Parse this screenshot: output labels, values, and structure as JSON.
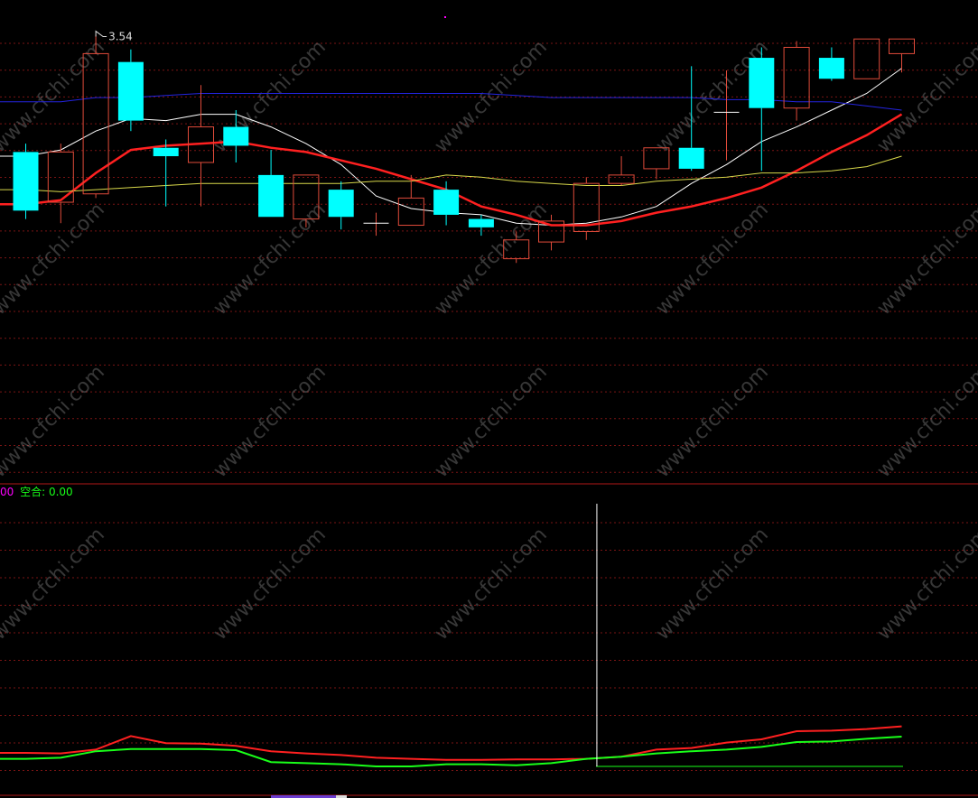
{
  "watermark": "www.cfchi.com",
  "colors": {
    "up": "#e04b3a",
    "down": "#00ffff",
    "ma5": "#ffffff",
    "ma10": "#ff2020",
    "ma20": "#d8d84a",
    "ma60": "#2424e0",
    "indicator_red": "#ff2020",
    "indicator_green": "#19ff19",
    "grid": "#7a1414"
  },
  "indicator": {
    "legend_left_fragment": "00",
    "legend_left_color": "#ff00ff",
    "legend_label": "空合: 0.00",
    "legend_color": "#19ff19"
  },
  "chart_data": [
    {
      "type": "candlestick",
      "title": "",
      "ylim": [
        2.05,
        3.62
      ],
      "high_marker": {
        "label": "3.54",
        "value": 3.54,
        "bar_index": 2
      },
      "candles": [
        {
          "open": 2.98,
          "close": 2.7,
          "high": 3.02,
          "low": 2.66
        },
        {
          "open": 2.74,
          "close": 2.98,
          "high": 3.02,
          "low": 2.64
        },
        {
          "open": 2.78,
          "close": 3.45,
          "high": 3.54,
          "low": 2.76
        },
        {
          "open": 3.41,
          "close": 3.13,
          "high": 3.47,
          "low": 3.08
        },
        {
          "open": 3.0,
          "close": 2.96,
          "high": 3.04,
          "low": 2.72
        },
        {
          "open": 2.93,
          "close": 3.1,
          "high": 3.3,
          "low": 2.72
        },
        {
          "open": 3.1,
          "close": 3.01,
          "high": 3.18,
          "low": 2.93
        },
        {
          "open": 2.87,
          "close": 2.67,
          "high": 2.99,
          "low": 2.67
        },
        {
          "open": 2.66,
          "close": 2.87,
          "high": 2.87,
          "low": 2.62
        },
        {
          "open": 2.8,
          "close": 2.67,
          "high": 2.84,
          "low": 2.61
        },
        {
          "open": 2.64,
          "close": 2.64,
          "high": 2.69,
          "low": 2.58
        },
        {
          "open": 2.63,
          "close": 2.76,
          "high": 2.87,
          "low": 2.63
        },
        {
          "open": 2.8,
          "close": 2.68,
          "high": 2.84,
          "low": 2.63
        },
        {
          "open": 2.66,
          "close": 2.62,
          "high": 2.68,
          "low": 2.58
        },
        {
          "open": 2.47,
          "close": 2.56,
          "high": 2.6,
          "low": 2.45
        },
        {
          "open": 2.55,
          "close": 2.65,
          "high": 2.68,
          "low": 2.51
        },
        {
          "open": 2.6,
          "close": 2.83,
          "high": 2.86,
          "low": 2.56
        },
        {
          "open": 2.83,
          "close": 2.87,
          "high": 2.96,
          "low": 2.82
        },
        {
          "open": 2.9,
          "close": 3.0,
          "high": 3.0,
          "low": 2.85
        },
        {
          "open": 3.0,
          "close": 2.9,
          "high": 3.39,
          "low": 2.89
        },
        {
          "open": 3.17,
          "close": 3.17,
          "high": 3.37,
          "low": 2.94
        },
        {
          "open": 3.43,
          "close": 3.19,
          "high": 3.48,
          "low": 2.89
        },
        {
          "open": 3.19,
          "close": 3.48,
          "high": 3.51,
          "low": 3.13
        },
        {
          "open": 3.43,
          "close": 3.33,
          "high": 3.48,
          "low": 3.32
        },
        {
          "open": 3.33,
          "close": 3.52,
          "high": 3.52,
          "low": 3.33
        },
        {
          "open": 3.45,
          "close": 3.52,
          "high": 3.52,
          "low": 3.36
        }
      ],
      "moving_averages": [
        {
          "color_key": "ma5",
          "width": 1,
          "values": [
            2.96,
            2.99,
            3.08,
            3.14,
            3.13,
            3.16,
            3.16,
            3.1,
            3.02,
            2.92,
            2.77,
            2.71,
            2.69,
            2.68,
            2.64,
            2.63,
            2.64,
            2.67,
            2.72,
            2.83,
            2.92,
            3.03,
            3.1,
            3.18,
            3.26,
            3.38
          ]
        },
        {
          "color_key": "ma10",
          "width": 2.5,
          "values": [
            2.73,
            2.75,
            2.88,
            2.99,
            3.01,
            3.02,
            3.03,
            3.0,
            2.98,
            2.94,
            2.9,
            2.85,
            2.8,
            2.72,
            2.68,
            2.63,
            2.63,
            2.65,
            2.69,
            2.72,
            2.76,
            2.81,
            2.89,
            2.98,
            3.06,
            3.16
          ]
        },
        {
          "color_key": "ma20",
          "width": 1,
          "values": [
            2.8,
            2.79,
            2.8,
            2.81,
            2.82,
            2.83,
            2.83,
            2.83,
            2.83,
            2.83,
            2.84,
            2.84,
            2.87,
            2.86,
            2.84,
            2.83,
            2.82,
            2.82,
            2.84,
            2.85,
            2.86,
            2.88,
            2.88,
            2.89,
            2.91,
            2.96
          ]
        },
        {
          "color_key": "ma60",
          "width": 1,
          "values": [
            3.22,
            3.22,
            3.24,
            3.24,
            3.25,
            3.26,
            3.26,
            3.26,
            3.26,
            3.26,
            3.26,
            3.26,
            3.26,
            3.26,
            3.25,
            3.24,
            3.24,
            3.24,
            3.24,
            3.24,
            3.23,
            3.23,
            3.22,
            3.22,
            3.2,
            3.18
          ]
        }
      ]
    },
    {
      "type": "line",
      "title": "",
      "ylim": [
        -0.2,
        6.0
      ],
      "series": [
        {
          "color_key": "indicator_red",
          "values": [
            0.25,
            0.24,
            0.31,
            0.56,
            0.43,
            0.42,
            0.38,
            0.28,
            0.24,
            0.21,
            0.16,
            0.14,
            0.12,
            0.12,
            0.13,
            0.13,
            0.14,
            0.18,
            0.31,
            0.34,
            0.44,
            0.5,
            0.65,
            0.66,
            0.69,
            0.74
          ]
        },
        {
          "color_key": "indicator_green",
          "values": [
            0.14,
            0.16,
            0.28,
            0.32,
            0.32,
            0.32,
            0.3,
            0.08,
            0.06,
            0.04,
            0.0,
            0.0,
            0.04,
            0.04,
            0.02,
            0.06,
            0.14,
            0.18,
            0.24,
            0.28,
            0.31,
            0.36,
            0.45,
            0.46,
            0.51,
            0.55
          ]
        }
      ],
      "spike": {
        "bar_index": 16.3,
        "value": 5.0
      }
    }
  ]
}
